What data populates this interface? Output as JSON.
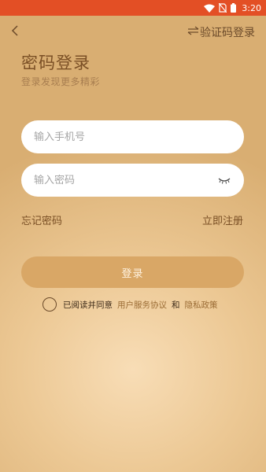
{
  "status_bar": {
    "time": "3:20",
    "icons": [
      "wifi-icon",
      "no-sim-icon",
      "battery-icon"
    ]
  },
  "header": {
    "back_icon": "chevron-left-icon",
    "switch_icon": "swap-arrows-icon",
    "switch_label": "验证码登录"
  },
  "title": "密码登录",
  "subtitle": "登录发现更多精彩",
  "phone_input": {
    "placeholder": "输入手机号",
    "value": ""
  },
  "password_input": {
    "placeholder": "输入密码",
    "value": "",
    "toggle_icon": "eye-closed-icon"
  },
  "links": {
    "forgot": "忘记密码",
    "register": "立即注册"
  },
  "login_button": "登录",
  "agreement": {
    "checked": false,
    "prefix": "已阅读并同意",
    "terms": "用户服务协议",
    "and": "和",
    "privacy": "隐私政策"
  },
  "colors": {
    "status_bar": "#e34f25",
    "title": "#7a4f25",
    "button": "#d9a766",
    "link": "#9b6c35"
  }
}
